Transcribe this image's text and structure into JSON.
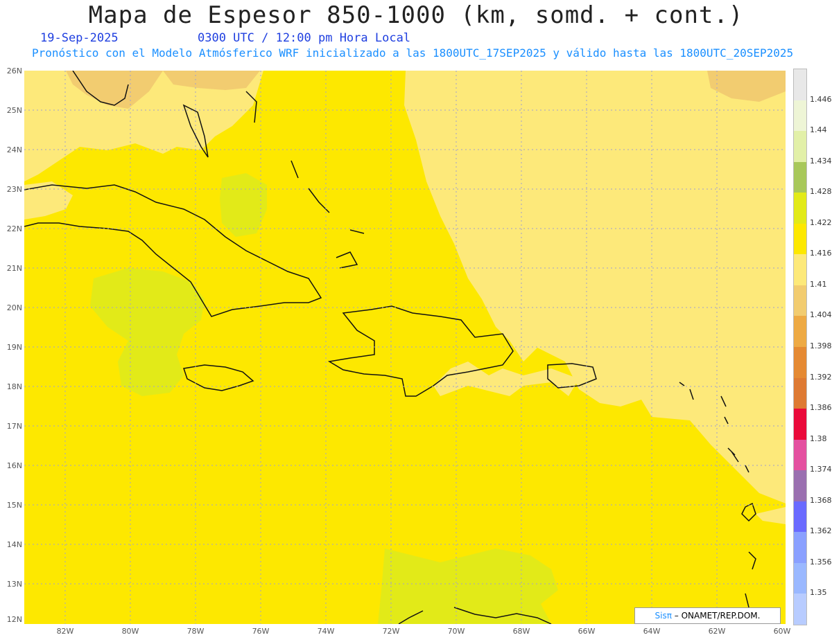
{
  "header": {
    "title": "Mapa de Espesor 850-1000 (km, somd. + cont.)",
    "date": "19-Sep-2025",
    "time": "0300 UTC / 12:00 pm Hora Local",
    "subtitle": "Pronóstico con el Modelo Atmósferico WRF inicializado a las 1800UTC_17SEP2025 y válido hasta las  1800UTC_20SEP2025"
  },
  "axes": {
    "lat_labels": [
      "26N",
      "25N",
      "24N",
      "23N",
      "22N",
      "21N",
      "20N",
      "19N",
      "18N",
      "17N",
      "16N",
      "15N",
      "14N",
      "13N",
      "12N"
    ],
    "lon_labels": [
      "82W",
      "80W",
      "78W",
      "76W",
      "74W",
      "72W",
      "70W",
      "68W",
      "66W",
      "64W",
      "62W",
      "60W"
    ]
  },
  "colorbar": {
    "labels": [
      "1.446",
      "1.44",
      "1.434",
      "1.428",
      "1.422",
      "1.416",
      "1.41",
      "1.404",
      "1.398",
      "1.392",
      "1.386",
      "1.38",
      "1.374",
      "1.368",
      "1.362",
      "1.356",
      "1.35"
    ],
    "colors": [
      "#e8e8e8",
      "#eef5d6",
      "#e2f0a8",
      "#a8c85a",
      "#e2ea18",
      "#fde800",
      "#fde97a",
      "#f2cc70",
      "#eeaa44",
      "#e58a33",
      "#de7a33",
      "#ea0a3a",
      "#e450a0",
      "#9a70b0",
      "#6a6aff",
      "#8aa0ff",
      "#9ab8ff",
      "#b8ccff"
    ]
  },
  "map": {
    "colors": {
      "base": "#fde800",
      "light": "#fde97a",
      "tan": "#f2cc70",
      "green": "#e2ea18",
      "coast": "#111111",
      "grid": "#a0a0d0"
    }
  },
  "credit": {
    "sis": "Sisπ",
    "text": " – ONAMET/REP.DOM."
  }
}
